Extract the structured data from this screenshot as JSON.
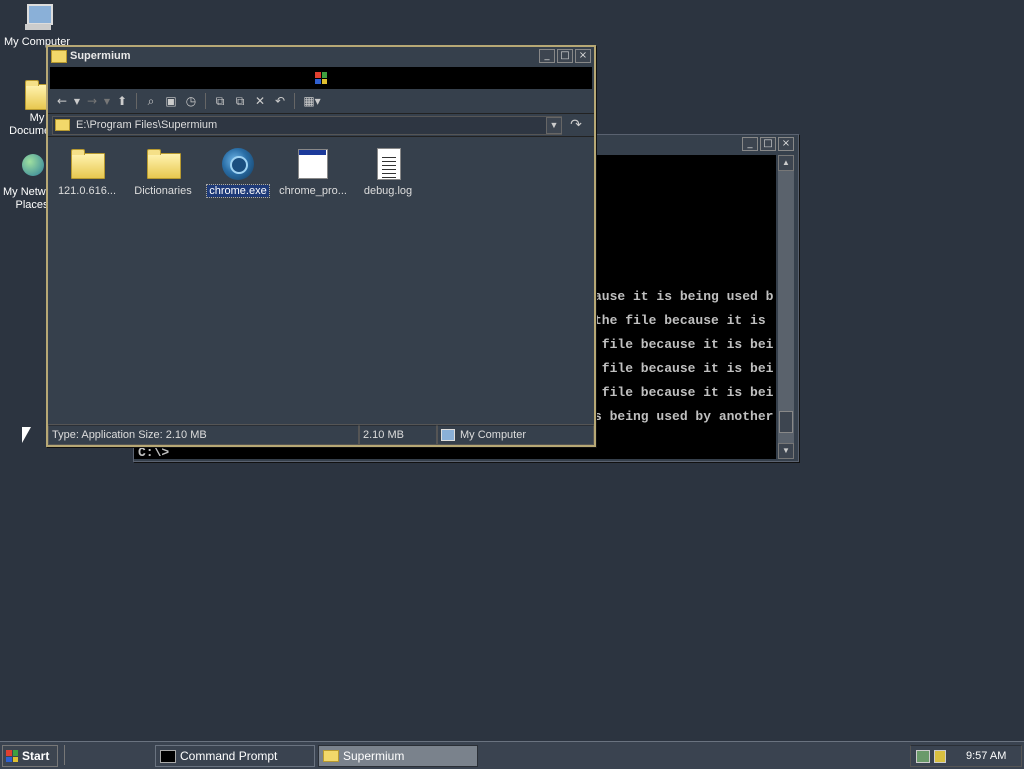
{
  "desktop": {
    "icons": [
      {
        "label": "My Computer",
        "icon": "my-computer-icon"
      },
      {
        "label": "My Documents",
        "icon": "my-documents-icon"
      },
      {
        "label": "My Network Places",
        "icon": "network-places-icon"
      }
    ]
  },
  "console": {
    "lines": [
      "ause it is being used b",
      "the file because it is",
      " file because it is bei",
      " file because it is bei",
      " file because it is bei",
      "s being used by another"
    ],
    "prompt": "C:\\>"
  },
  "explorer": {
    "title": "Supermium",
    "address": "E:\\Program Files\\Supermium",
    "files": [
      {
        "name": "121.0.616...",
        "icon": "folder-icon"
      },
      {
        "name": "Dictionaries",
        "icon": "folder-icon"
      },
      {
        "name": "chrome.exe",
        "icon": "chrome-exe-icon",
        "selected": true
      },
      {
        "name": "chrome_pro...",
        "icon": "application-window-icon"
      },
      {
        "name": "debug.log",
        "icon": "text-document-icon"
      }
    ],
    "status": {
      "type_size": "Type: Application Size: 2.10 MB",
      "size": "2.10 MB",
      "zone": "My Computer"
    }
  },
  "taskbar": {
    "start": "Start",
    "tasks": [
      "Command Prompt",
      "Supermium"
    ],
    "clock": "9:57 AM"
  }
}
